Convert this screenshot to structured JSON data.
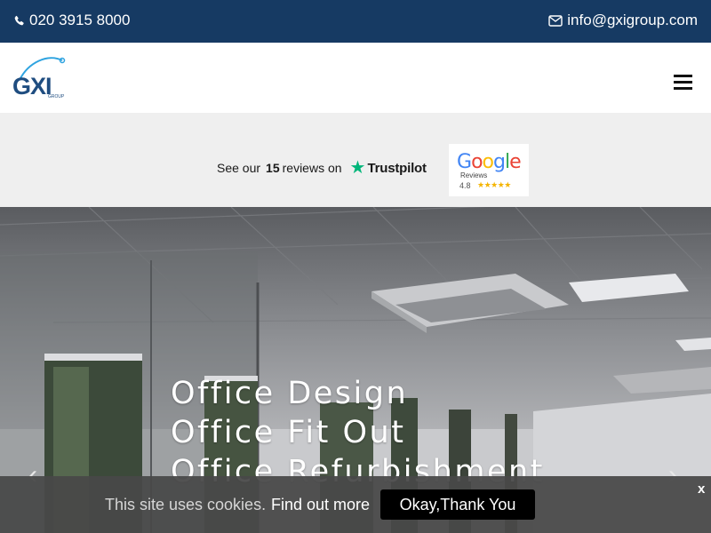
{
  "topbar": {
    "phone": "020 3915 8000",
    "email": "info@gxigroup.com",
    "phone_icon": "phone-icon",
    "email_icon": "envelope-icon",
    "background": "#163a63"
  },
  "header": {
    "logo_text": "GXI",
    "logo_subtext": "GROUP",
    "menu_icon": "hamburger-icon"
  },
  "reviews": {
    "trustpilot_prefix": "See our",
    "trustpilot_count": "15",
    "trustpilot_suffix": "reviews on",
    "trustpilot_brand": "Trustpilot",
    "trustpilot_star_color": "#00b67a",
    "google_word": "Google",
    "google_sub": "Reviews",
    "google_rating": "4.8",
    "google_stars": 5
  },
  "hero": {
    "lines": [
      "Office Design",
      "Office Fit Out",
      "Office Refurbishment"
    ],
    "prev_icon": "chevron-left-icon",
    "next_icon": "chevron-right-icon"
  },
  "cookie": {
    "message": "This site uses cookies.",
    "link": "Find out more",
    "accept": "Okay,Thank You",
    "close": "x"
  }
}
